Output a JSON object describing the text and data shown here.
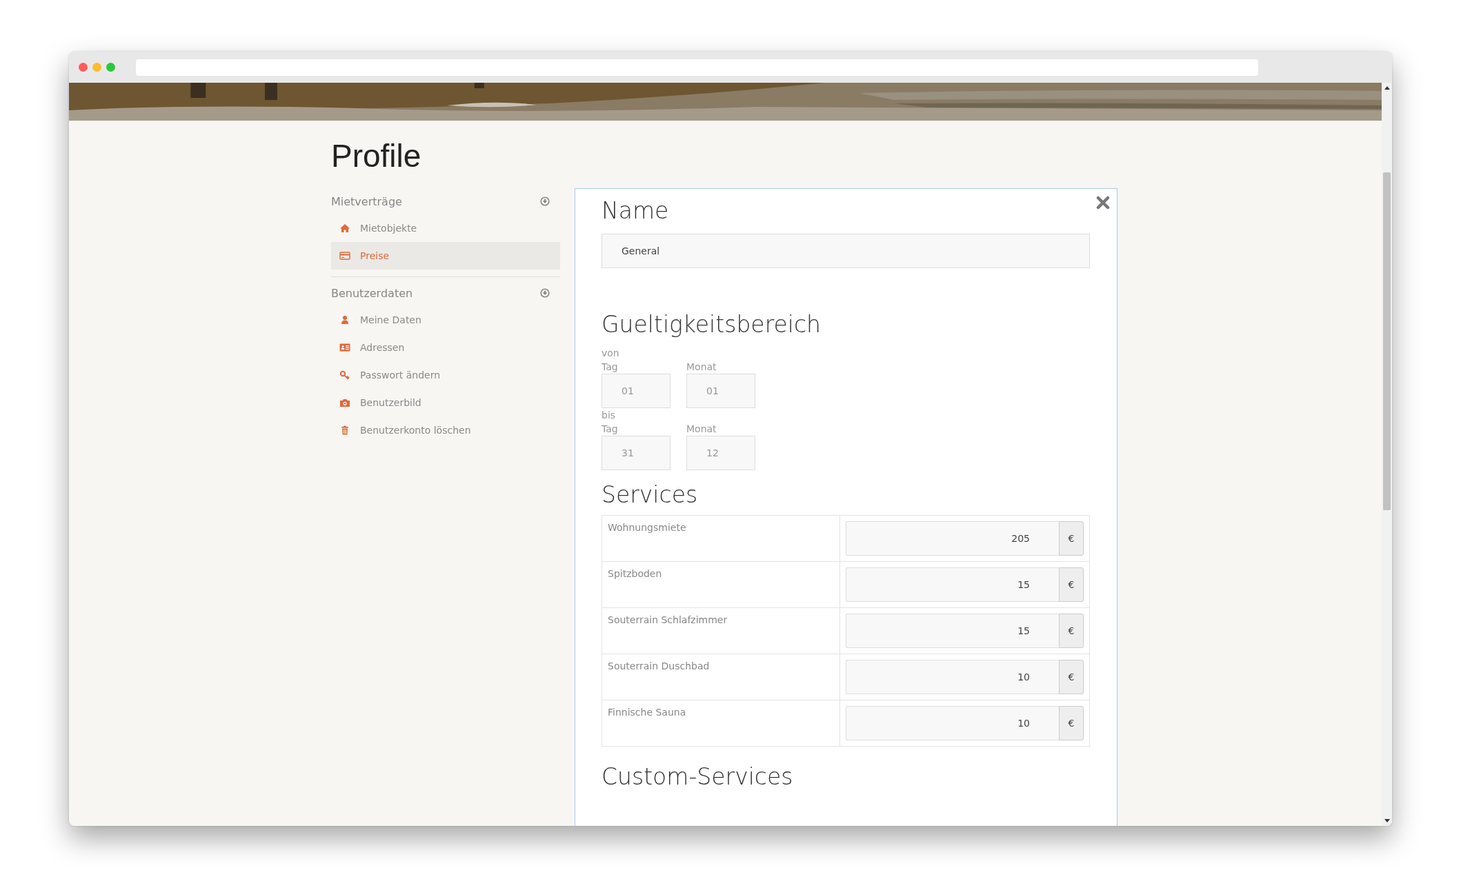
{
  "page": {
    "title": "Profile"
  },
  "sidebar": {
    "sections": [
      {
        "title": "Mietverträge",
        "items": [
          {
            "label": "Mietobjekte",
            "selected": false
          },
          {
            "label": "Preise",
            "selected": true
          }
        ]
      },
      {
        "title": "Benutzerdaten",
        "items": [
          {
            "label": "Meine Daten",
            "selected": false
          },
          {
            "label": "Adressen",
            "selected": false
          },
          {
            "label": "Passwort ändern",
            "selected": false
          },
          {
            "label": "Benutzerbild",
            "selected": false
          },
          {
            "label": "Benutzerkonto löschen",
            "selected": false
          }
        ]
      }
    ]
  },
  "form": {
    "name_section": {
      "heading": "Name",
      "value": "General"
    },
    "validity": {
      "heading": "Gueltigkeitsbereich",
      "ranges": [
        {
          "label": "von",
          "day_label": "Tag",
          "day": "01",
          "month_label": "Monat",
          "month": "01"
        },
        {
          "label": "bis",
          "day_label": "Tag",
          "day": "31",
          "month_label": "Monat",
          "month": "12"
        }
      ]
    },
    "services": {
      "heading": "Services",
      "rows": [
        {
          "name": "Wohnungsmiete",
          "value": "205",
          "currency": "€"
        },
        {
          "name": "Spitzboden",
          "value": "15",
          "currency": "€"
        },
        {
          "name": "Souterrain Schlafzimmer",
          "value": "15",
          "currency": "€"
        },
        {
          "name": "Souterrain Duschbad",
          "value": "10",
          "currency": "€"
        },
        {
          "name": "Finnische Sauna",
          "value": "10",
          "currency": "€"
        }
      ]
    },
    "custom_services": {
      "heading": "Custom-Services"
    }
  }
}
